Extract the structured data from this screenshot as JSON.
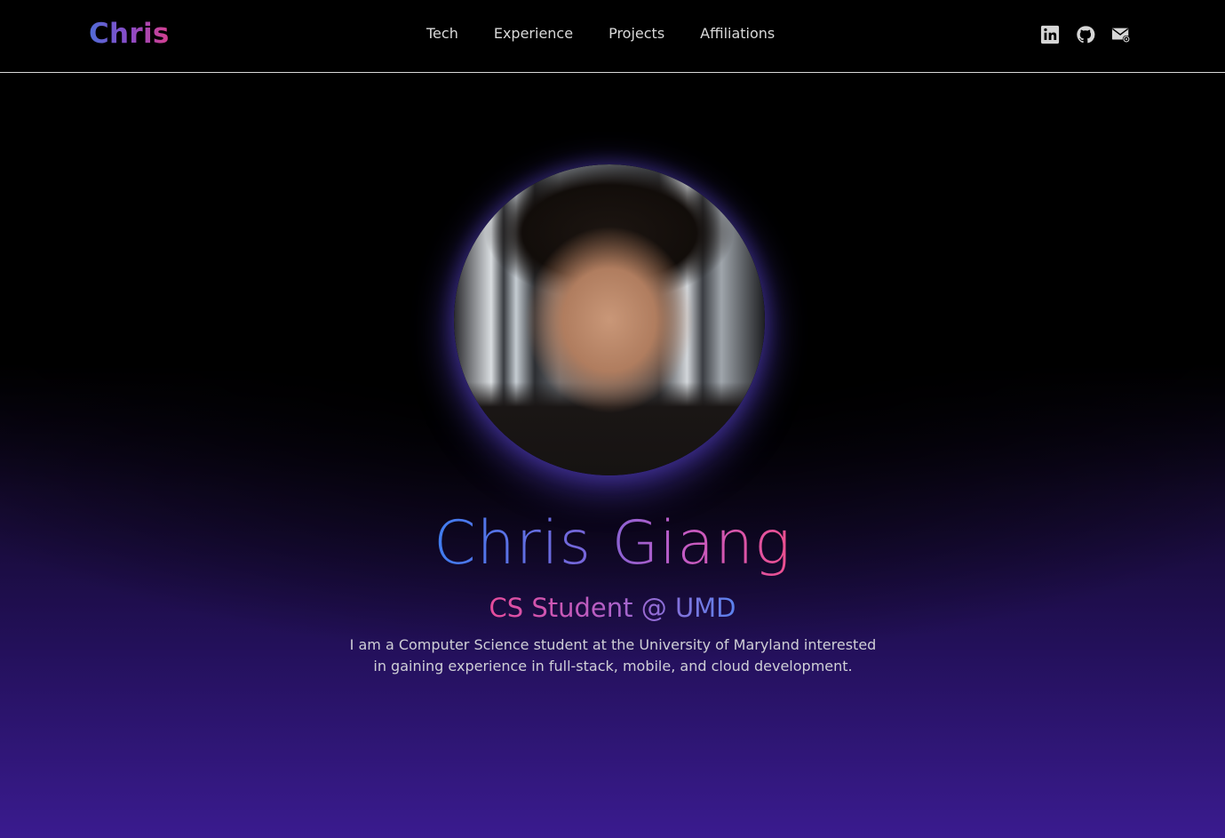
{
  "navbar": {
    "brand": "Chris",
    "links": [
      {
        "label": "Tech"
      },
      {
        "label": "Experience"
      },
      {
        "label": "Projects"
      },
      {
        "label": "Affiliations"
      }
    ],
    "socials": [
      {
        "icon": "linkedin-icon"
      },
      {
        "icon": "github-icon"
      },
      {
        "icon": "email-icon"
      }
    ]
  },
  "hero": {
    "name": "Chris Giang",
    "subtitle": "CS Student @ UMD",
    "bio": "I am a Computer Science student at the University of Maryland interested in gaining experience in full-stack, mobile, and cloud development."
  },
  "colors": {
    "background": "#000000",
    "gradient_purple": "#3a1b8f",
    "accent_blue": "#3f7df0",
    "accent_pink": "#ee4f8f"
  }
}
